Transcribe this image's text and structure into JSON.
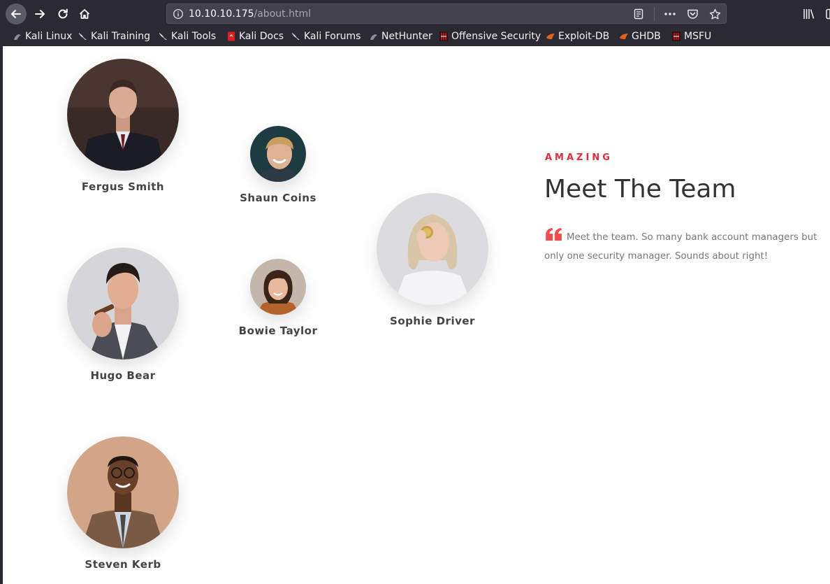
{
  "browser": {
    "url_host": "10.10.10.175",
    "url_path": "/about.html",
    "bookmarks": [
      {
        "label": "Kali Linux",
        "icon": "kali-dragon-icon"
      },
      {
        "label": "Kali Training",
        "icon": "kali-dragon-icon"
      },
      {
        "label": "Kali Tools",
        "icon": "kali-dragon-icon"
      },
      {
        "label": "Kali Docs",
        "icon": "kali-docs-icon"
      },
      {
        "label": "Kali Forums",
        "icon": "kali-dragon-icon"
      },
      {
        "label": "NetHunter",
        "icon": "nethunter-icon"
      },
      {
        "label": "Offensive Security",
        "icon": "offsec-icon"
      },
      {
        "label": "Exploit-DB",
        "icon": "exploit-db-icon"
      },
      {
        "label": "GHDB",
        "icon": "ghdb-icon"
      },
      {
        "label": "MSFU",
        "icon": "offsec-icon"
      }
    ]
  },
  "team": {
    "subheading": "AMAZING",
    "heading": "Meet The Team",
    "quote": "Meet the team. So many bank account managers but only one security manager. Sounds about right!",
    "members": [
      {
        "name": "Fergus Smith"
      },
      {
        "name": "Shaun Coins"
      },
      {
        "name": "Hugo Bear"
      },
      {
        "name": "Bowie Taylor"
      },
      {
        "name": "Sophie Driver"
      },
      {
        "name": "Steven Kerb"
      }
    ]
  },
  "colors": {
    "accent": "#e02e3a",
    "chrome": "#2b2a33",
    "urlbar": "#42414d"
  }
}
